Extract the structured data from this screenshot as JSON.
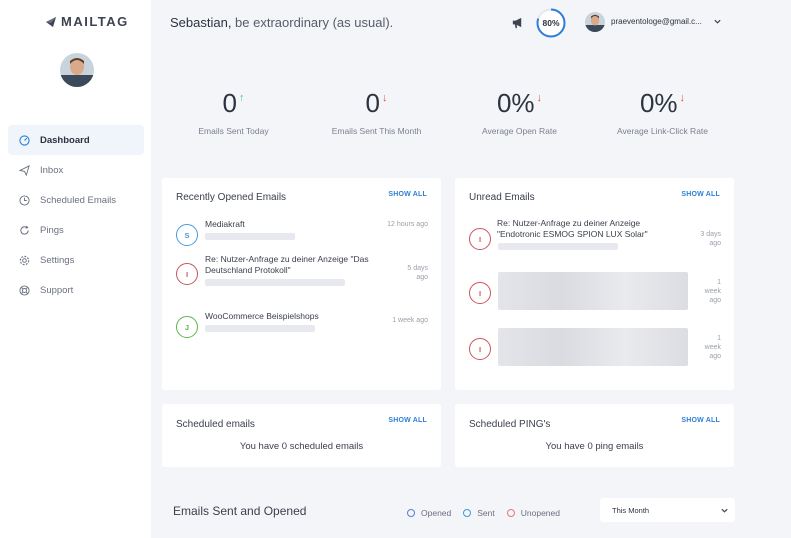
{
  "app": {
    "logo_text": "MAILTAG"
  },
  "header": {
    "greeting_name": "Sebastian,",
    "greeting_rest": " be extraordinary (as usual).",
    "progress_text": "80%",
    "progress_value": 0.8,
    "email": "praeventologe@gmail.c...",
    "accent_color": "#2d7fd6"
  },
  "sidebar": {
    "items": [
      {
        "label": "Dashboard",
        "icon": "gauge-icon",
        "active": true
      },
      {
        "label": "Inbox",
        "icon": "paper-plane-icon"
      },
      {
        "label": "Scheduled Emails",
        "icon": "clock-icon"
      },
      {
        "label": "Pings",
        "icon": "refresh-icon"
      },
      {
        "label": "Settings",
        "icon": "gear-icon"
      },
      {
        "label": "Support",
        "icon": "lifebuoy-icon"
      }
    ]
  },
  "stats": [
    {
      "value": "0",
      "arrow": "↑",
      "direction": "up",
      "label": "Emails Sent Today"
    },
    {
      "value": "0",
      "arrow": "↓",
      "direction": "down",
      "label": "Emails Sent This Month"
    },
    {
      "value": "0%",
      "arrow": "↓",
      "direction": "down",
      "label": "Average Open Rate"
    },
    {
      "value": "0%",
      "arrow": "↓",
      "direction": "down",
      "label": "Average Link-Click Rate"
    }
  ],
  "recently_opened": {
    "title": "Recently Opened Emails",
    "show_all": "SHOW ALL",
    "items": [
      {
        "badge": "S",
        "badge_color": "blue",
        "title": "Mediakraft",
        "time": "12 hours ago"
      },
      {
        "badge": "I",
        "badge_color": "red",
        "title": "Re: Nutzer-Anfrage zu deiner Anzeige \"Das Deutschland Protokoll\"",
        "time": "5 days ago"
      },
      {
        "badge": "J",
        "badge_color": "green",
        "title": "WooCommerce Beispielshops",
        "time": "1 week ago"
      }
    ]
  },
  "unread": {
    "title": "Unread Emails",
    "show_all": "SHOW ALL",
    "items": [
      {
        "badge": "I",
        "title": "Re: Nutzer-Anfrage zu deiner Anzeige \"Endotronic ESMOG SPION LUX Solar\"",
        "time": "3 days ago"
      },
      {
        "badge": "I",
        "title": "",
        "time": "1 week ago"
      },
      {
        "badge": "I",
        "title": "",
        "time": "1 week ago"
      }
    ]
  },
  "scheduled_emails": {
    "title": "Scheduled emails",
    "show_all": "SHOW ALL",
    "text": "You have 0 scheduled emails"
  },
  "scheduled_pings": {
    "title": "Scheduled PING's",
    "show_all": "SHOW ALL",
    "text": "You have 0 ping emails"
  },
  "chart_section": {
    "title": "Emails Sent and Opened",
    "legend": [
      {
        "label": "Opened",
        "color": "#5b7fd3"
      },
      {
        "label": "Sent",
        "color": "#3a9bd8"
      },
      {
        "label": "Unopened",
        "color": "#e07a7e"
      }
    ],
    "period": "This Month"
  }
}
